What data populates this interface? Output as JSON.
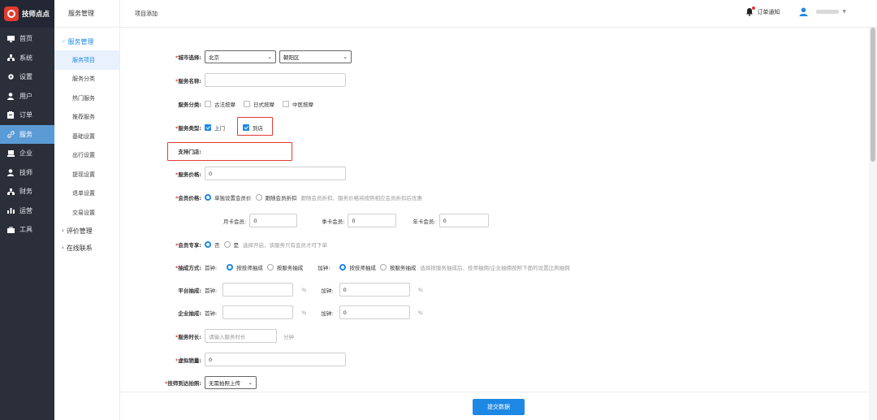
{
  "app": {
    "name": "技师点点"
  },
  "sidebar": {
    "items": [
      {
        "label": "首页",
        "icon": "monitor-icon"
      },
      {
        "label": "系统",
        "icon": "sitemap-icon"
      },
      {
        "label": "设置",
        "icon": "gear-icon"
      },
      {
        "label": "用户",
        "icon": "user-icon"
      },
      {
        "label": "订单",
        "icon": "clipboard-icon"
      },
      {
        "label": "服务",
        "icon": "link-icon",
        "active": true
      },
      {
        "label": "企业",
        "icon": "laptop-icon"
      },
      {
        "label": "技师",
        "icon": "user-icon"
      },
      {
        "label": "财务",
        "icon": "sitemap-icon"
      },
      {
        "label": "运营",
        "icon": "chart-icon"
      },
      {
        "label": "工具",
        "icon": "briefcase-icon"
      }
    ]
  },
  "sub_sidebar": {
    "header": "服务管理",
    "group_open": "服务管理",
    "items": [
      "服务项目",
      "服务分类",
      "热门服务",
      "推荐服务",
      "基础设置",
      "出行设置",
      "提现设置",
      "退单设置",
      "交易设置"
    ],
    "groups_closed": [
      "评价管理",
      "在线联系"
    ]
  },
  "topbar": {
    "breadcrumb": "项目添加",
    "notifications": "订单通知"
  },
  "form": {
    "city": {
      "label": "城市选择:",
      "city_value": "北京",
      "district_value": "朝阳区"
    },
    "name": {
      "label": "服务名称:",
      "value": ""
    },
    "category": {
      "label": "服务分类:",
      "options": [
        "古法按摩",
        "日式按摩",
        "中医按摩"
      ]
    },
    "type": {
      "label": "服务类型:",
      "options": [
        "上门",
        "到店"
      ]
    },
    "stores": {
      "label": "支持门店:"
    },
    "price": {
      "label": "服务价格:",
      "value": "0"
    },
    "member_price": {
      "label": "会员价格:",
      "options": [
        "单独设置会员价",
        "跟随会员折扣"
      ],
      "hint": "跟随会员折扣、服务价格将按照相应会员折扣后优惠",
      "month_label": "月卡会员:",
      "month_value": "0",
      "season_label": "季卡会员:",
      "season_value": "0",
      "year_label": "年卡会员:",
      "year_value": "0"
    },
    "member_only": {
      "label": "会员专享:",
      "options": [
        "否",
        "是"
      ],
      "hint": "选择开启、该服务只有会员才可下单"
    },
    "commission": {
      "label": "抽成方式:",
      "first_label": "首钟:",
      "add_label": "加钟:",
      "options": [
        "按技师抽成",
        "按服务抽成"
      ],
      "hint": "选择按服务抽成后、技师抽佣/企业抽佣按照下面的设置比例抽佣"
    },
    "platform": {
      "label": "平台抽成:",
      "first_label": "首钟:",
      "add_label": "加钟:",
      "add_value": "0",
      "unit": "%"
    },
    "company": {
      "label": "企业抽成:",
      "first_label": "首钟:",
      "add_label": "加钟:",
      "add_value": "0",
      "unit": "%"
    },
    "duration": {
      "label": "服务时长:",
      "placeholder": "请输入服务时长",
      "unit": "分钟"
    },
    "sales": {
      "label": "虚拟销量:",
      "value": "0"
    },
    "arrival_photo": {
      "label": "技师到达拍照:",
      "value": "无需拍照上传"
    }
  },
  "submit_label": "提交数据",
  "colors": {
    "primary": "#1e88e5",
    "sidebar_bg": "#2b2f3a",
    "highlight_box": "#e53935"
  }
}
